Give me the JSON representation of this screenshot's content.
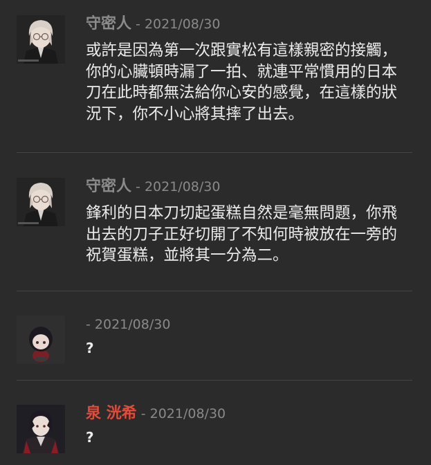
{
  "messages": [
    {
      "author": "守密人",
      "separator": " - ",
      "date": "2021/08/30",
      "text": "或許是因為第一次跟實松有這樣親密的接觸，你的心臟頓時漏了一拍、就連平常慣用的日本刀在此時都無法給你心安的感覺，在這樣的狀況下，你不小心將其摔了出去。",
      "author_color": "#8b8b8b"
    },
    {
      "author": "守密人",
      "separator": " - ",
      "date": "2021/08/30",
      "text": "鋒利的日本刀切起蛋糕自然是毫無問題，你飛出去的刀子正好切開了不知何時被放在一旁的祝賀蛋糕，並將其一分為二。",
      "author_color": "#8b8b8b"
    },
    {
      "author": "",
      "separator": " - ",
      "date": "2021/08/30",
      "text": "?",
      "author_color": "#8b8b8b"
    },
    {
      "author": "泉 洸希",
      "separator": " - ",
      "date": "2021/08/30",
      "text": "?",
      "author_color": "#e34b3b"
    }
  ]
}
